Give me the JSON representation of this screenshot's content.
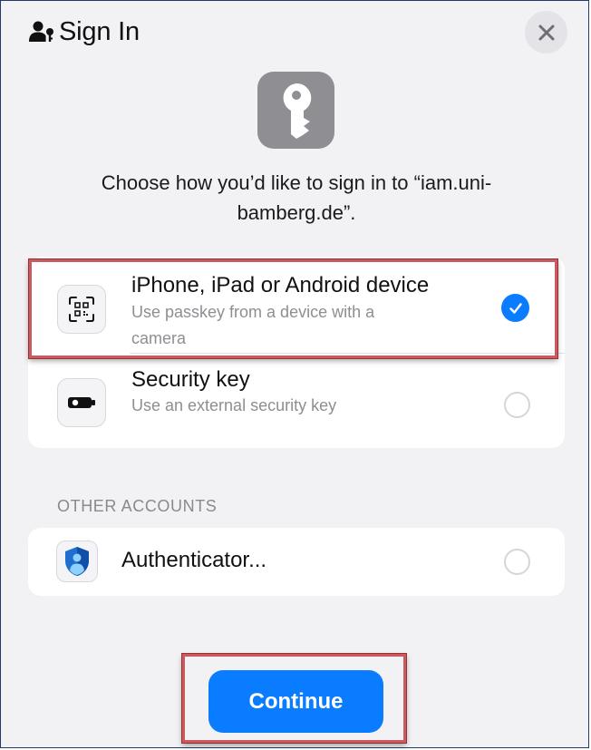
{
  "header": {
    "title": "Sign In",
    "icon": "person-key-icon"
  },
  "prompt": "Choose how you’d like to sign in to “iam.uni-bamberg.de”.",
  "options": [
    {
      "title": "iPhone, iPad or Android device",
      "subtitle": "Use passkey from a device with a camera",
      "icon": "qr-scan-icon",
      "selected": true
    },
    {
      "title": "Security key",
      "subtitle": "Use an external security key",
      "icon": "security-key-icon",
      "selected": false
    }
  ],
  "other_accounts": {
    "label": "OTHER ACCOUNTS",
    "items": [
      {
        "title": "Authenticator...",
        "icon": "authenticator-icon",
        "selected": false
      }
    ]
  },
  "continue_label": "Continue",
  "colors": {
    "accent": "#0a7cff",
    "highlight": "#c95a5f",
    "background": "#f2f2f4"
  }
}
